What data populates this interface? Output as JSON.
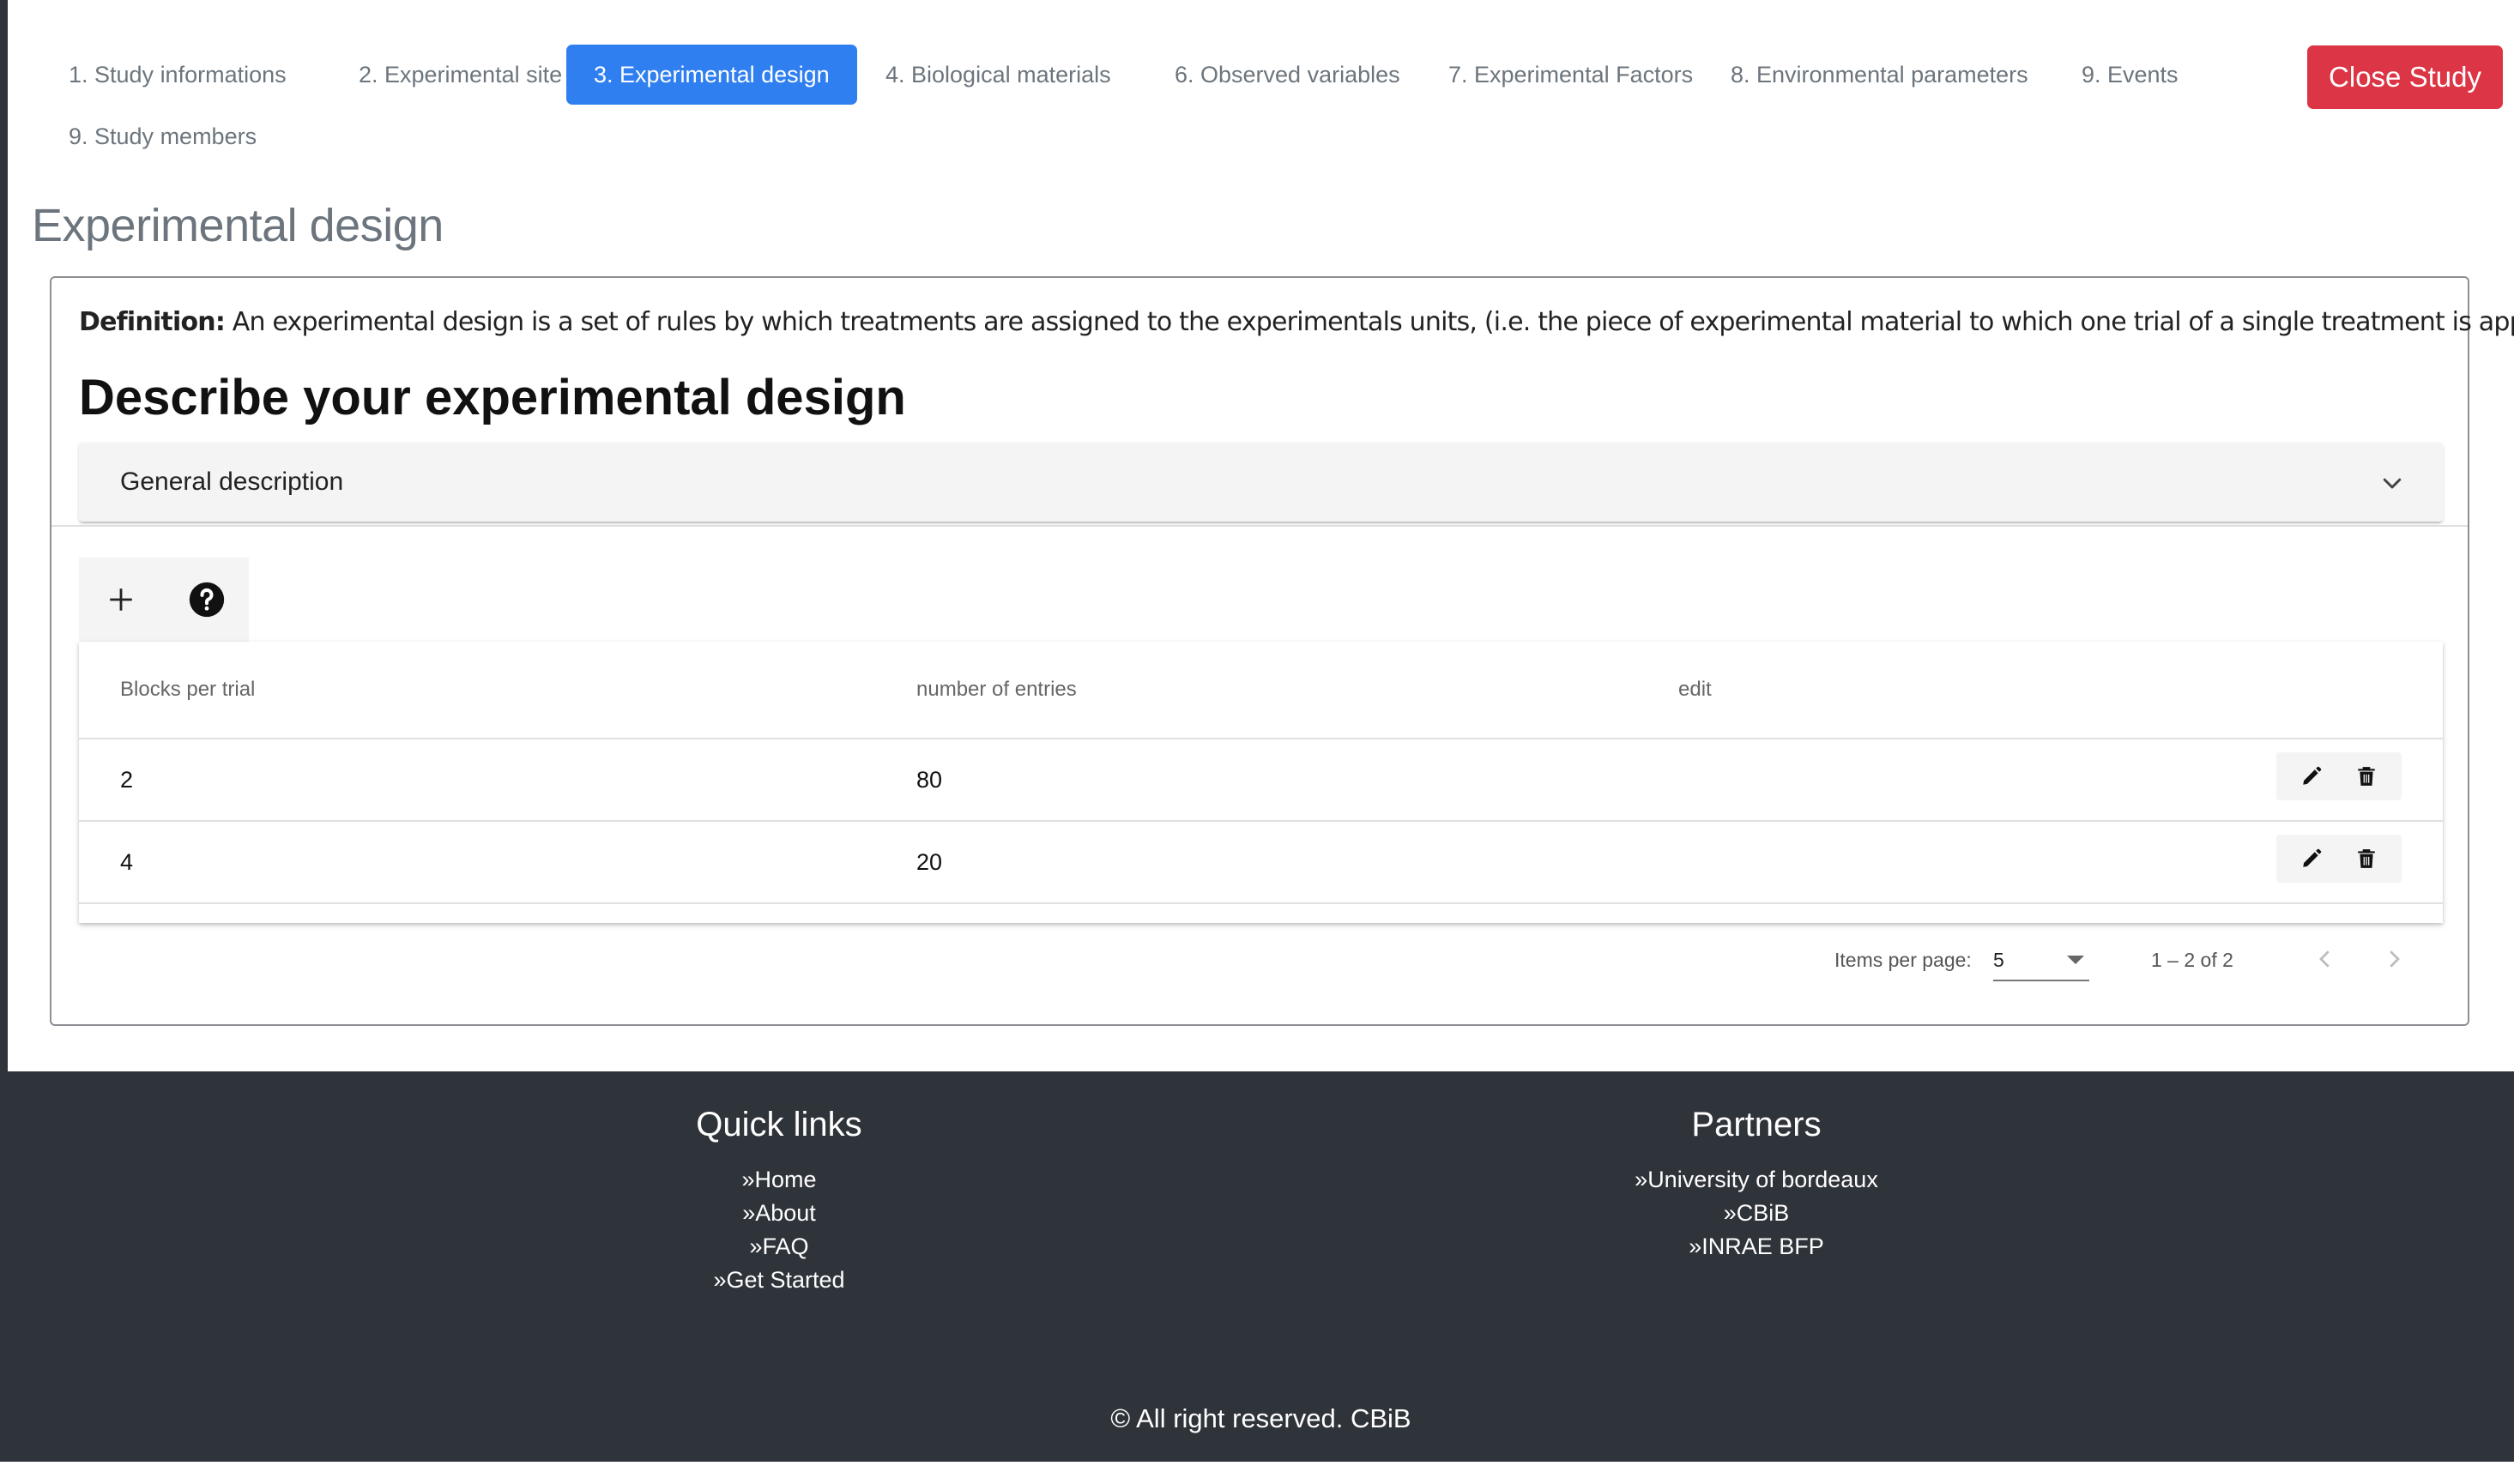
{
  "tabs": [
    {
      "label": "1. Study informations"
    },
    {
      "label": "2. Experimental site"
    },
    {
      "label": "3. Experimental design",
      "active": true
    },
    {
      "label": "4. Biological materials"
    },
    {
      "label": "6. Observed variables"
    },
    {
      "label": "7. Experimental Factors"
    },
    {
      "label": "8. Environmental parameters"
    },
    {
      "label": "9. Events"
    },
    {
      "label": "9. Study members"
    }
  ],
  "close_button": "Close Study",
  "page_title": "Experimental design",
  "definition": {
    "label": "Definition:",
    "text": " An experimental design is a set of rules by which treatments are assigned to the experimentals units, (i.e. the piece of experimental material to which one trial of a single treatment is applied)."
  },
  "section_heading": "Describe your experimental design",
  "expansion_panel": {
    "title": "General description"
  },
  "toolbar": {
    "add_icon": "plus-icon",
    "help_icon": "question-circle-icon"
  },
  "table": {
    "columns": [
      "Blocks per trial",
      "number of entries",
      "edit"
    ],
    "rows": [
      {
        "blocks": "2",
        "entries": "80"
      },
      {
        "blocks": "4",
        "entries": "20"
      }
    ],
    "row_actions": [
      "pencil-icon",
      "trash-icon"
    ]
  },
  "paginator": {
    "items_per_page_label": "Items per page:",
    "items_per_page_value": "5",
    "range_label": "1 – 2 of 2"
  },
  "footer": {
    "quick_links": {
      "title": "Quick links",
      "links": [
        "»Home",
        "»About",
        "»FAQ",
        "»Get Started"
      ]
    },
    "partners": {
      "title": "Partners",
      "links": [
        "»University of bordeaux",
        "»CBiB",
        "»INRAE BFP"
      ]
    },
    "copyright": "© All right reserved.  CBiB"
  },
  "colors": {
    "primary": "#2f7ff0",
    "danger": "#dc3545",
    "footer_bg": "#2f333a"
  }
}
